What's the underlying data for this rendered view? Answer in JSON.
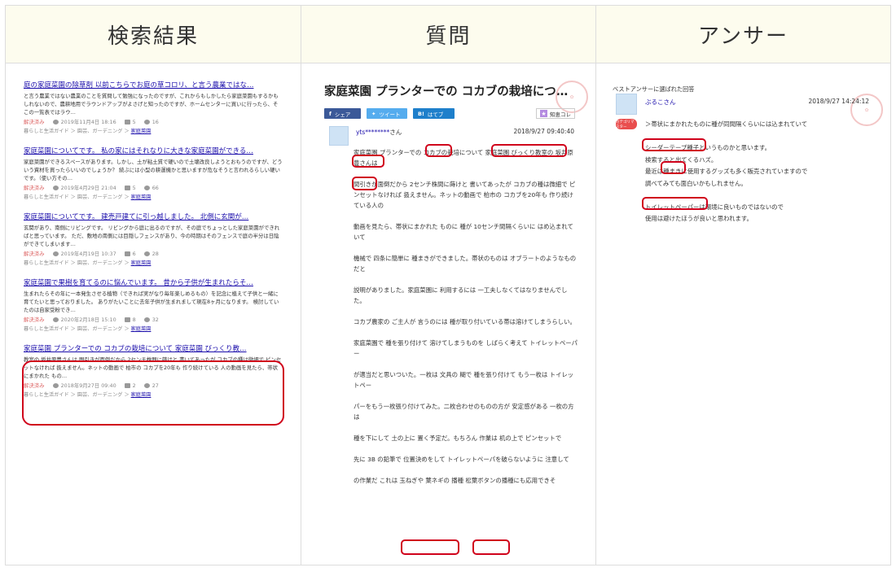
{
  "headers": {
    "search": "検索結果",
    "question": "質問",
    "answer": "アンサー"
  },
  "results": [
    {
      "title": "庭の家庭菜園の除草剤 以前こちらでお庭の草コロリ、と言う農業ではな…",
      "snippet": "と言う農業ではない農業のことを質問して勉強になったのですが、これからもしかしたら家庭菜園もするかもしれないので、農耕地用でラウンドアップがよさげと知ったのですが、ホームセンターに買いに行ったら、そこの一覧表ではラウ…",
      "status": "解決済み",
      "date": "2019年11月4日 18:16",
      "comments": "5",
      "views": "16",
      "category": "暮らしと生活ガイド ＞ 園芸、ガーデニング ＞",
      "category_link": "家庭菜園"
    },
    {
      "title": "家庭菜園についてです。 私の家にはそれなりに大きな家庭菜園ができる…",
      "snippet": "家庭菜園ができるスペースがあります。しかし、土が粘土質で硬いので土壌改良しようとおもうのですが、どういう資材を買ったらいいのでしょうか？ 続ぶには小型の耕運機かと思いますが危なそうと言われるらしい硬いです。（使い方その…",
      "status": "解決済み",
      "date": "2019年4月29日 21:04",
      "comments": "5",
      "views": "66",
      "category": "暮らしと生活ガイド ＞ 園芸、ガーデニング ＞",
      "category_link": "家庭菜園"
    },
    {
      "title": "家庭菜園についてです。 建売戸建てに引っ越しました。 北側に玄関が…",
      "snippet": "玄関があり、南側にリビングです。 リビングから庭に出るのですが、その庭でちょっとした家庭菜園ができればと思っています。 ただ、敷地の南側には目隠しフェンスがあり、今の時期はそのフェンスで庭の半分は日陰ができてしまいます…",
      "status": "解決済み",
      "date": "2019年4月19日 10:37",
      "comments": "6",
      "views": "28",
      "category": "暮らしと生活ガイド ＞ 園芸、ガーデニング ＞",
      "category_link": "家庭菜園"
    },
    {
      "title": "家庭菜園で果樹を育てるのに悩んでいます。 昔から子供が生まれたらそ…",
      "snippet": "生まれたらその年に一本発生させる植物（できれば実がなり毎年楽しめるもの）を記念に植えて子供と一緒に育てたいと思っておりました。 ありがたいことに去年子供が生まれまして現在8ヶ月になります。 検討していたのは自家受粉でき…",
      "status": "解決済み",
      "date": "2020年2月18日 15:10",
      "comments": "8",
      "views": "32",
      "category": "暮らしと生活ガイド ＞ 園芸、ガーデニング ＞",
      "category_link": "家庭菜園"
    },
    {
      "title": "家庭菜園 プランターでの コカブの栽培について 家庭菜園 びっくり教…",
      "snippet": "教室の 坂井原豊さんは 間引きが面倒だから 2センチ株間に蒔けと 書いてあったが コカブの種は微細で ピンセットなければ 扱えません。ネットの動画で 柏市の コカブを20年も 作り続けている 人の動画を見たら、帯状にまかれた もの…",
      "status": "解決済み",
      "date": "2018年9月27日 09:40",
      "comments": "2",
      "views": "27",
      "category": "暮らしと生活ガイド ＞ 園芸、ガーデニング ＞",
      "category_link": "家庭菜園"
    }
  ],
  "question": {
    "title": "家庭菜園 プランターでの コカブの栽培につい…",
    "share": {
      "facebook": "シェア",
      "twitter": "ツイート",
      "hatena": "はてブ",
      "hatena_icon": "B!"
    },
    "chie": "知恵コレ",
    "user": "yts********",
    "san": "さん",
    "date": "2018/9/27 09:40:40",
    "paragraphs": [
      "家庭菜園 プランターでの コカブの栽培について 家庭菜園 びっくり教室の 坂井原豊さんは",
      "間引きが面倒だから 2センチ株間に蒔けと 書いてあったが コカブの種は微細で ピンセットなければ 扱えません。ネットの動画で 柏市の コカブを20年も 作り続けている人の",
      "動画を見たら、帯状にまかれた ものに 種が 10センチ間隔くらいに はめ込まれていて",
      "機械で 四条に簡単に 種まきができました。帯状のものは オブラートのようなものだと",
      "説明がありました。家庭菜園に 利用するには 一工夫しなくてはなりませんでした。",
      "コカブ農家の ご主人が 言うのには 種が取り付いている帯は溶けてしまうらしい。",
      "家庭菜園で 種を張り付けて 溶けてしまうものを しばらく考えて トイレットペーパー",
      "が適当だと思いついた。一枚は 文具の 糊で 種を張り付けて もう一枚は トイレットペー",
      "パーをもう一枚張り付けてみた。二枚合わせのものの方が 安定感がある 一枚の方は",
      "種を下にして 土の上に 置く予定だ。もちろん 作業は 机の上で ピンセットで",
      "先に 3B の鉛筆で 位置決めをして トイレットペーパを破らないように 注意して",
      "の作業だ これは 玉ねぎや 葉ネギの 播種 松葉ボタンの播種にも応用できそ"
    ]
  },
  "answer": {
    "label": "ベストアンサーに選ばれた回答",
    "user": "ぶるこさん",
    "date": "2018/9/27 14:24:12",
    "badge": "カテゴリマスター",
    "quote": "＞帯状にまかれたものに種が同間隔くらいには込まれていて",
    "paragraphs": [
      [
        "シーダーテープ種子というものかと思います。",
        "検索すると出てくるハズ。",
        "最近は種まきに使用するグッズも多く販売されていますので",
        "調べてみても面白いかもしれません。"
      ],
      [
        "トイレットペーパーは環境に良いものではないので",
        "使用は避けたほうが良いと思われます。"
      ]
    ]
  }
}
